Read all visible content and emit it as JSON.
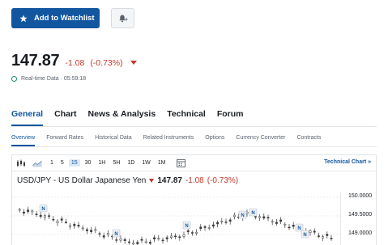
{
  "header": {
    "watchlist_label": "Add to Watchlist"
  },
  "quote": {
    "price": "147.87",
    "change": "-1.08",
    "change_pct": "(-0.73%)",
    "realtime_label": "Real-time Data · 05:59:18"
  },
  "tabs": [
    {
      "label": "General",
      "active": true
    },
    {
      "label": "Chart",
      "active": false
    },
    {
      "label": "News & Analysis",
      "active": false
    },
    {
      "label": "Technical",
      "active": false
    },
    {
      "label": "Forum",
      "active": false
    }
  ],
  "subnav": [
    {
      "label": "Overview",
      "active": true
    },
    {
      "label": "Forward Rates",
      "active": false
    },
    {
      "label": "Historical Data",
      "active": false
    },
    {
      "label": "Related Instruments",
      "active": false
    },
    {
      "label": "Options",
      "active": false
    },
    {
      "label": "Currency Converter",
      "active": false
    },
    {
      "label": "Contracts",
      "active": false
    }
  ],
  "chart": {
    "timeframes": [
      "1",
      "5",
      "15",
      "30",
      "1H",
      "5H",
      "1D",
      "1W",
      "1M"
    ],
    "active_timeframe": "15",
    "technical_link": "Technical Chart »",
    "symbol_title": "USD/JPY - US Dollar Japanese Yen",
    "price": "147.87",
    "change": "-1.08",
    "change_pct": "(-0.73%)",
    "y_ticks": [
      "150.0000",
      "149.5000",
      "149.0000"
    ],
    "news_marker": "N"
  },
  "colors": {
    "brand_blue": "#1256a0",
    "negative_red": "#c0392b",
    "candle": "#3a3a3a"
  }
}
